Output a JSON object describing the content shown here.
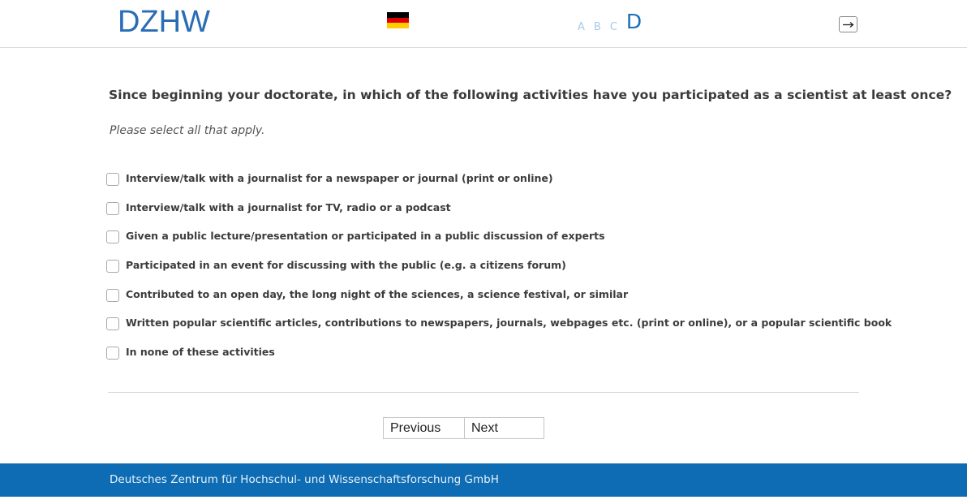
{
  "header": {
    "logo_text": "DZHW",
    "language_flag": "germany-flag",
    "flag_colors": [
      "#000000",
      "#dd0000",
      "#ffce00"
    ],
    "font_sizes": [
      "A",
      "B",
      "C",
      "D"
    ],
    "active_font_size": "D",
    "exit_icon": "logout-icon"
  },
  "main": {
    "question": "Since beginning your doctorate, in which of the following activities have you participated as a scientist at least once?",
    "instruction": "Please select all that apply.",
    "options": [
      "Interview/talk with a journalist for a newspaper or journal (print or online)",
      "Interview/talk with a journalist for TV, radio or a podcast",
      "Given a public lecture/presentation or participated in a public discussion of experts",
      "Participated in an event for discussing with the public (e.g. a citizens forum)",
      "Contributed to an open day, the long night of the sciences, a science festival, or similar",
      "Written popular scientific articles, contributions to newspapers, journals, webpages etc. (print or online), or a popular scientific book",
      "In none of these activities"
    ]
  },
  "navigation": {
    "previous_label": "Previous",
    "next_label": "Next"
  },
  "footer": {
    "text": "Deutsches Zentrum für Hochschul- und Wissenschaftsforschung GmbH",
    "color": "#0d6cb3"
  }
}
